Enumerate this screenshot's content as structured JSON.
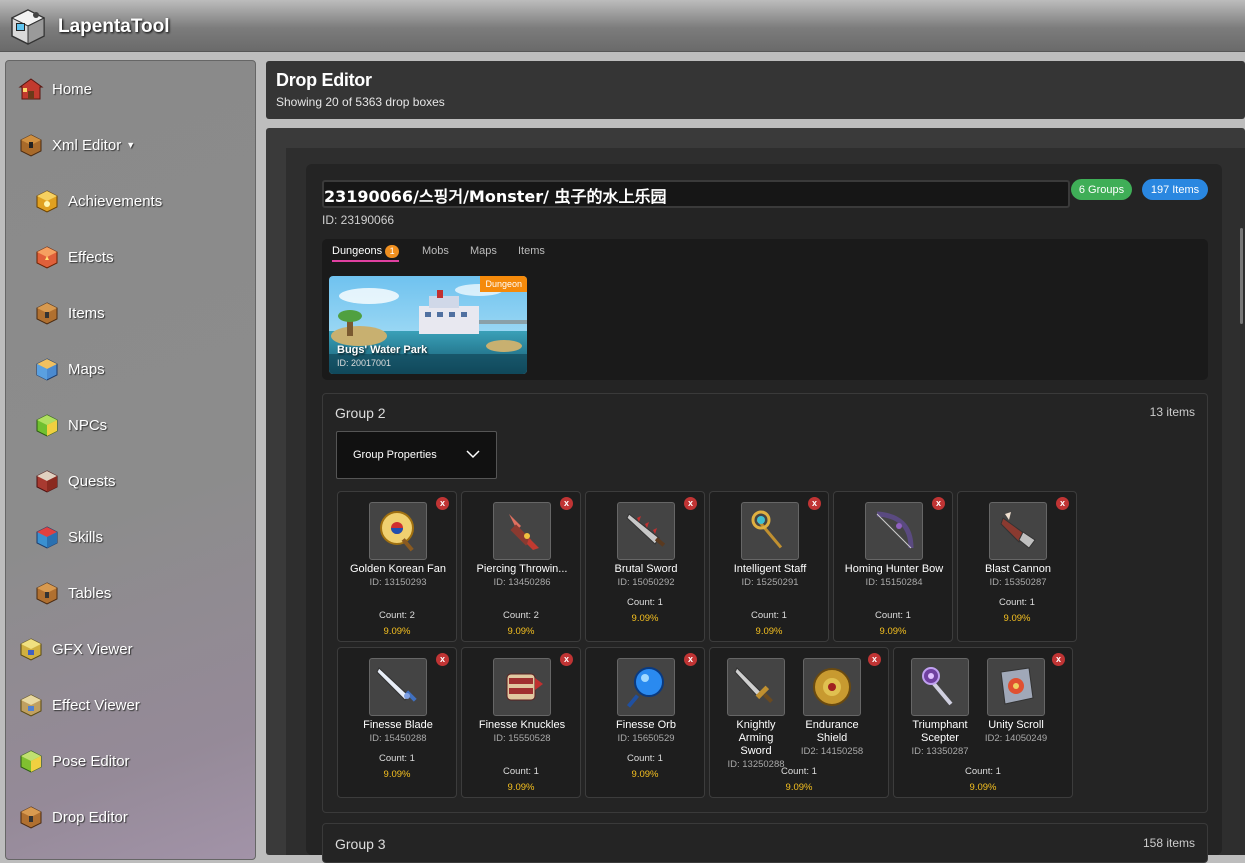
{
  "app": {
    "title": "LapentaTool"
  },
  "sidebar": {
    "home": "Home",
    "xml_editor": "Xml Editor",
    "sub": [
      "Achievements",
      "Effects",
      "Items",
      "Maps",
      "NPCs",
      "Quests",
      "Skills",
      "Tables"
    ],
    "tools": [
      "GFX Viewer",
      "Effect Viewer",
      "Pose Editor",
      "Drop Editor"
    ]
  },
  "header": {
    "title": "Drop Editor",
    "subtitle": "Showing 20 of 5363 drop boxes"
  },
  "box": {
    "name": "23190066/스핑거/Monster/ 虫子的水上乐园",
    "id": "ID: 23190066",
    "groups_pill": "6 Groups",
    "items_pill": "197 Items"
  },
  "tabs": {
    "dungeons": "Dungeons",
    "dungeons_count": "1",
    "mobs": "Mobs",
    "maps": "Maps",
    "items": "Items"
  },
  "dungeon": {
    "tag": "Dungeon",
    "name": "Bugs' Water Park",
    "id": "ID: 20017001"
  },
  "group2": {
    "title": "Group 2",
    "count": "13 items",
    "props_label": "Group Properties",
    "cells": [
      {
        "items": [
          {
            "name": "Golden Korean Fan",
            "id": "ID: 13150293",
            "icon": "fan-icon"
          }
        ],
        "count": "Count: 2",
        "pct": "9.09%"
      },
      {
        "items": [
          {
            "name": "Piercing Throwin...",
            "id": "ID: 13450286",
            "icon": "throwing-star-icon"
          }
        ],
        "count": "Count: 2",
        "pct": "9.09%"
      },
      {
        "items": [
          {
            "name": "Brutal Sword",
            "id": "ID: 15050292",
            "icon": "sword-icon"
          }
        ],
        "count": "Count: 1",
        "pct": "9.09%"
      },
      {
        "items": [
          {
            "name": "Intelligent Staff",
            "id": "ID: 15250291",
            "icon": "staff-icon"
          }
        ],
        "count": "Count: 1",
        "pct": "9.09%"
      },
      {
        "items": [
          {
            "name": "Homing Hunter Bow",
            "id": "ID: 15150284",
            "icon": "bow-icon"
          }
        ],
        "count": "Count: 1",
        "pct": "9.09%"
      },
      {
        "items": [
          {
            "name": "Blast Cannon",
            "id": "ID: 15350287",
            "icon": "cannon-icon"
          }
        ],
        "count": "Count: 1",
        "pct": "9.09%"
      },
      {
        "items": [
          {
            "name": "Finesse Blade",
            "id": "ID: 15450288",
            "icon": "blade-icon"
          }
        ],
        "count": "Count: 1",
        "pct": "9.09%"
      },
      {
        "items": [
          {
            "name": "Finesse Knuckles",
            "id": "ID: 15550528",
            "icon": "knuckles-icon"
          }
        ],
        "count": "Count: 1",
        "pct": "9.09%"
      },
      {
        "items": [
          {
            "name": "Finesse Orb",
            "id": "ID: 15650529",
            "icon": "orb-icon"
          }
        ],
        "count": "Count: 1",
        "pct": "9.09%"
      },
      {
        "items": [
          {
            "name": "Knightly Arming Sword",
            "id": "ID: 13250288",
            "icon": "arming-sword-icon"
          },
          {
            "name": "Endurance Shield",
            "id": "ID2: 14150258",
            "icon": "shield-icon"
          }
        ],
        "count": "Count: 1",
        "pct": "9.09%"
      },
      {
        "items": [
          {
            "name": "Triumphant Scepter",
            "id": "ID: 13350287",
            "icon": "scepter-icon"
          },
          {
            "name": "Unity Scroll",
            "id": "ID2: 14050249",
            "icon": "scroll-icon"
          }
        ],
        "count": "Count: 1",
        "pct": "9.09%"
      }
    ]
  },
  "group3": {
    "title": "Group 3",
    "count": "158 items"
  },
  "remove_label": "x",
  "colors": {
    "groups_pill": "#3fae57",
    "items_pill": "#2a87e0",
    "percent": "#f5c020",
    "tab_underline": "#e040a0"
  }
}
